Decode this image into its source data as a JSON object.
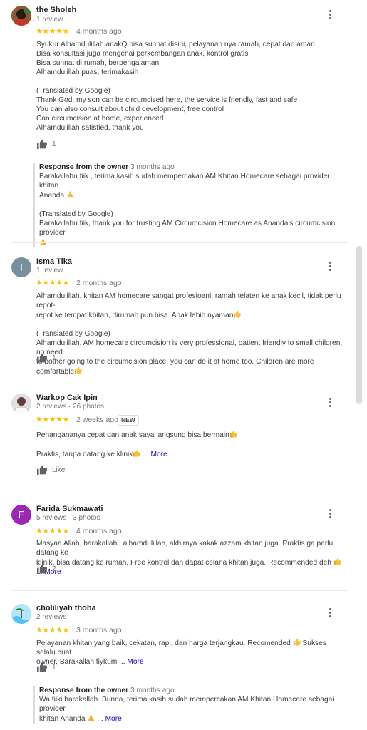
{
  "reviews": [
    {
      "name": "the Sholeh",
      "meta": "1 review",
      "stars": "★★★★★",
      "when": "4 months ago",
      "text": [
        "Syukur Alhamdulillah anakQ bisa sunnat disini, pelayanan nya ramah, cepat dan aman",
        "Bisa konsultasi juga mengenai perkembangan anak, kontrol gratis",
        "Bisa sunnat di rumah, berpengalaman",
        "Alhamdulillah puas, terimakasih",
        "",
        "(Translated by Google)",
        "Thank God, my son can be circumcised here, the service is friendly, fast and safe",
        "You can also consult about child development, free control",
        "Can circumcision at home, experienced",
        "Alhamdulillah satisfied, thank you"
      ],
      "likes": "1",
      "owner": {
        "head": "Response from the owner",
        "when": "3 months ago",
        "line1": "Barakallahu fiik , terima kasih sudah mempercakan AM Khitan Homecare sebagai provider khitan",
        "line2": "Ananda",
        "line3": "(Translated by Google)",
        "line4": "Barakallahu fiik, thank you for trusting AM Circumcision Homecare as Ananda's circumcision provider"
      }
    },
    {
      "name": "Isma Tika",
      "meta": "1 review",
      "initial": "I",
      "stars": "★★★★★",
      "when": "2 months ago",
      "text1": "Alhamdulillah, khitan AM homecare sangat profesioanl, ramah telaten ke anak kecil, tidak perlu repot-",
      "text2": "repot ke tempat khitan, dirumah pun bisa. Anak lebih nyaman",
      "text3": "(Translated by Google)",
      "text4": "Alhamdulillah, AM homecare circumcision is very professional, patient friendly to small children, no need",
      "text5": "to bother going to the circumcision place, you can do it at home too. Children are more comfortable",
      "likes": "1"
    },
    {
      "name": "Warkop Cak Ipin",
      "meta": "2 reviews · 26 photos",
      "stars": "★★★★★",
      "when": "2 weeks ago",
      "badge": "NEW",
      "text1": "Penangananya cepat dan anak saya langsung bisa bermain",
      "text2": "Praktis, tanpa datang ke klinik",
      "more": " ... More",
      "likes": "Like"
    },
    {
      "name": "Farida Sukmawati",
      "meta": "5 reviews · 3 photos",
      "initial": "F",
      "stars": "★★★★★",
      "when": "4 months ago",
      "text1": "Masyaa Allah, barakallah...alhamdulillah, akhirnya kakak azzam khitan juga. Praktis ga perlu datang ke",
      "text2": "klinik, bisa datang ke rumah. Free kontrol dan dapat celana khitan juga. Recommended deh",
      "more": " ... More",
      "likes": "2"
    },
    {
      "name": "choliliyah thoha",
      "meta": "2 reviews",
      "stars": "★★★★★",
      "when": "3 months ago",
      "text1a": "Pelayanan khitan yang baik, cekatan, rapi, dan harga terjangkau. Recomended",
      "text1b": " Sukses selalu buat",
      "text2": "owner, Barakallah fiykum",
      "more": " ... More",
      "likes": "1",
      "owner": {
        "head": "Response from the owner",
        "when": "3 months ago",
        "line1": "Wa fiiki barakallah. Bunda, terima kasih sudah mempercakan AM Khitan Homecare sebagai provider",
        "line2": "khitan Ananda",
        "more": " ... More"
      }
    }
  ],
  "colors": {
    "star": "#fbbc04",
    "link": "#1a0dab",
    "muted": "#70757a"
  },
  "icons": [
    "thumbs-up-icon",
    "more-vert-icon",
    "thumbs-up-emoji",
    "folded-hands-emoji"
  ]
}
